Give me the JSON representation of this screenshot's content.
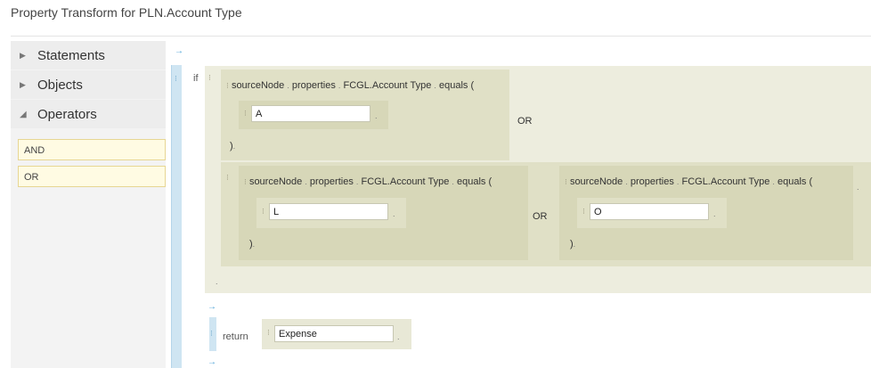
{
  "title": "Property Transform for PLN.Account Type",
  "left_panel": {
    "sections": [
      {
        "label": "Statements",
        "expanded": false
      },
      {
        "label": "Objects",
        "expanded": false
      },
      {
        "label": "Operators",
        "expanded": true
      }
    ],
    "operators": [
      "AND",
      "OR"
    ]
  },
  "editor": {
    "if_label": "if",
    "return_label": "return",
    "or_label": "OR",
    "expr1": {
      "tokens": [
        "sourceNode",
        "properties",
        "FCGL.Account Type",
        "equals ("
      ],
      "value": "A",
      "close": ")"
    },
    "expr2": {
      "tokens": [
        "sourceNode",
        "properties",
        "FCGL.Account Type",
        "equals ("
      ],
      "value": "L",
      "close": ")"
    },
    "expr3": {
      "tokens": [
        "sourceNode",
        "properties",
        "FCGL.Account Type",
        "equals ("
      ],
      "value": "O",
      "close": ")"
    },
    "return_value": "Expense"
  }
}
